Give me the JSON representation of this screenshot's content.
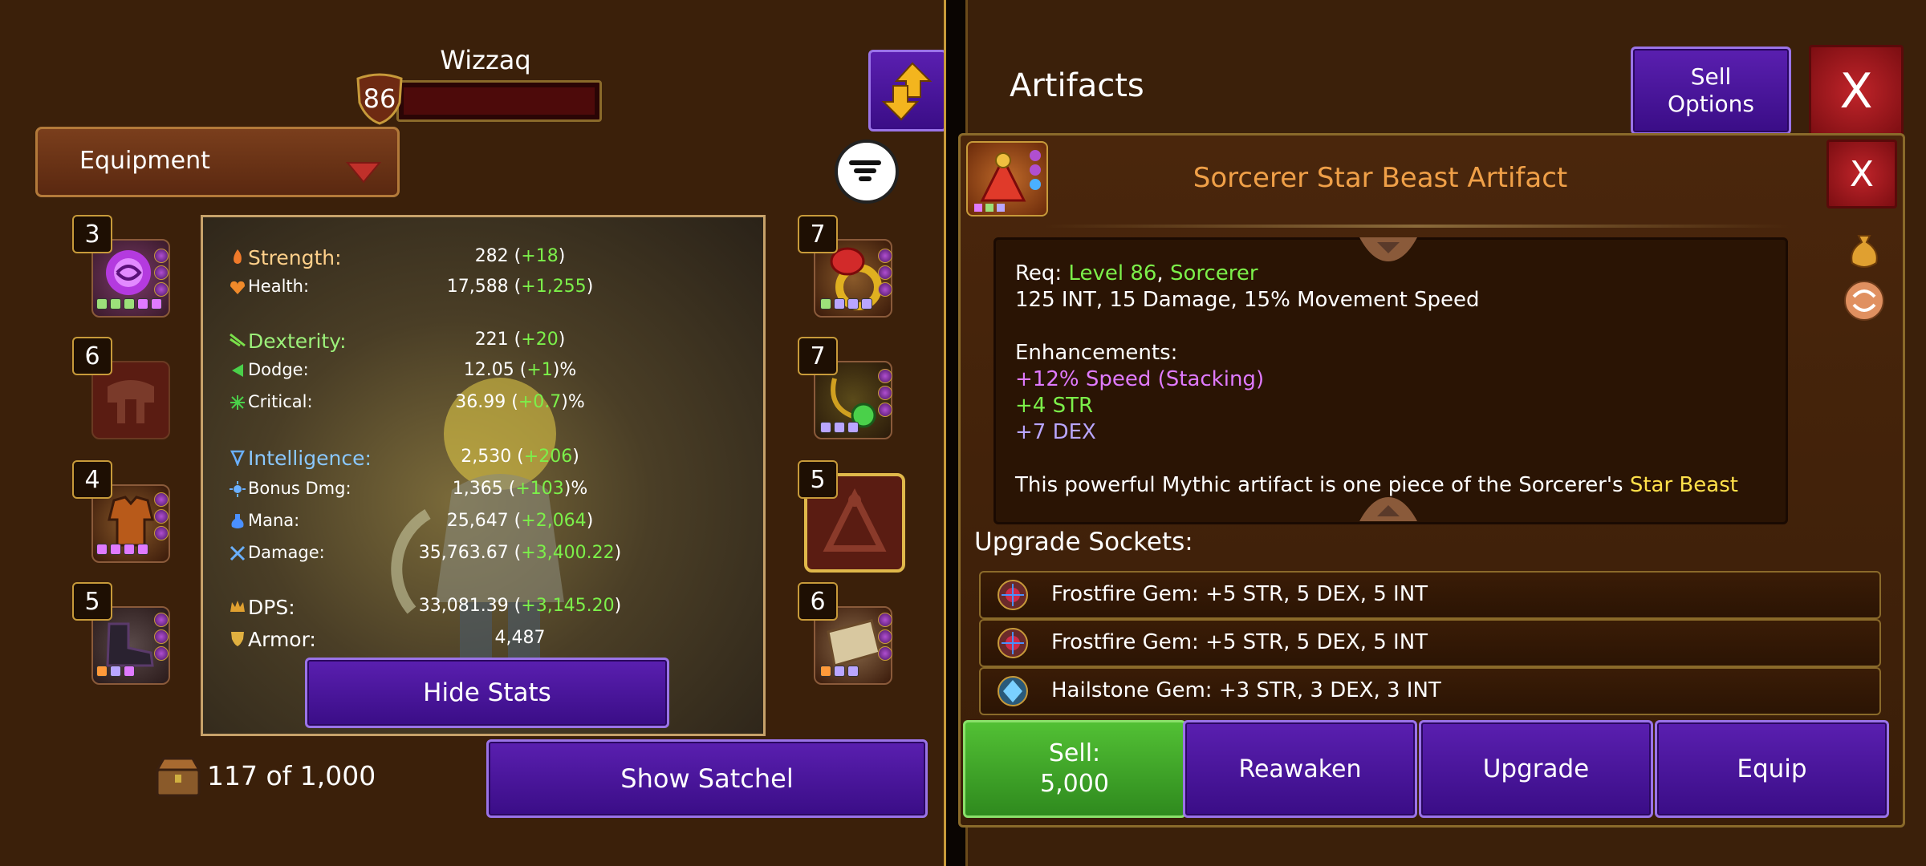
{
  "character": {
    "name": "Wizzaq",
    "level": "86"
  },
  "inventory": {
    "category": "Equipment",
    "count": "117 of 1,000",
    "show_satchel": "Show Satchel",
    "hide_stats": "Hide Stats"
  },
  "left_slots": [
    {
      "level": "3",
      "icon": "orb-icon"
    },
    {
      "level": "6",
      "icon": "helmet-silhouette-icon"
    },
    {
      "level": "4",
      "icon": "armor-icon"
    },
    {
      "level": "5",
      "icon": "boots-icon"
    }
  ],
  "right_slots": [
    {
      "level": "7",
      "icon": "ring-icon"
    },
    {
      "level": "7",
      "icon": "amulet-icon"
    },
    {
      "level": "5",
      "icon": "artifact-silhouette-icon"
    },
    {
      "level": "6",
      "icon": "scroll-icon"
    }
  ],
  "stats": {
    "strength_label": "Strength:",
    "strength": "282",
    "strength_bonus": "+18",
    "health_label": "Health:",
    "health": "17,588",
    "health_bonus": "+1,255",
    "dexterity_label": "Dexterity:",
    "dexterity": "221",
    "dexterity_bonus": "+20",
    "dodge_label": "Dodge:",
    "dodge": "12.05",
    "dodge_bonus": "+1",
    "critical_label": "Critical:",
    "critical": "36.99",
    "critical_bonus": "+0.7",
    "intelligence_label": "Intelligence:",
    "intelligence": "2,530",
    "intelligence_bonus": "+206",
    "bonus_dmg_label": "Bonus Dmg:",
    "bonus_dmg": "1,365",
    "bonus_dmg_bonus": "+103",
    "mana_label": "Mana:",
    "mana": "25,647",
    "mana_bonus": "+2,064",
    "damage_label": "Damage:",
    "damage": "35,763.67",
    "damage_bonus": "+3,400.22",
    "dps_label": "DPS:",
    "dps": "33,081.39",
    "dps_bonus": "+3,145.20",
    "armor_label": "Armor:",
    "armor": "4,487"
  },
  "artifacts": {
    "title": "Artifacts",
    "sell_options": "Sell Options",
    "close": "X"
  },
  "item": {
    "name": "Sorcerer Star Beast Artifact",
    "close": "X",
    "req_prefix": "Req: ",
    "req_level": "Level 86",
    "req_sep": ", ",
    "req_class": "Sorcerer",
    "base_stats": "125 INT, 15 Damage, 15% Movement Speed",
    "enh_title": "Enhancements:",
    "enh_1": "+12% Speed (Stacking)",
    "enh_2": "+4 STR",
    "enh_3": "+7 DEX",
    "desc_start": "This powerful Mythic artifact is one piece of the Sorcerer's ",
    "desc_highlight": "Star Beast",
    "sockets_title": "Upgrade Sockets:",
    "sockets": [
      "Frostfire Gem: +5 STR, 5 DEX, 5 INT",
      "Frostfire Gem: +5 STR, 5 DEX, 5 INT",
      "Hailstone Gem: +3 STR, 3 DEX, 3 INT"
    ],
    "sell_label": "Sell:",
    "sell_price": "5,000",
    "reawaken": "Reawaken",
    "upgrade": "Upgrade",
    "equip": "Equip"
  },
  "colors": {
    "accent_purple": "#4a16a0",
    "sell_green": "#3fa52a",
    "gold": "#c79a3a",
    "item_name": "#f0a048",
    "req_green": "#7cf04a",
    "enh_pink": "#e07aff",
    "enh_green": "#7cf04a",
    "enh_lilac": "#b9a6ff",
    "highlight_yellow": "#ffe14a"
  }
}
